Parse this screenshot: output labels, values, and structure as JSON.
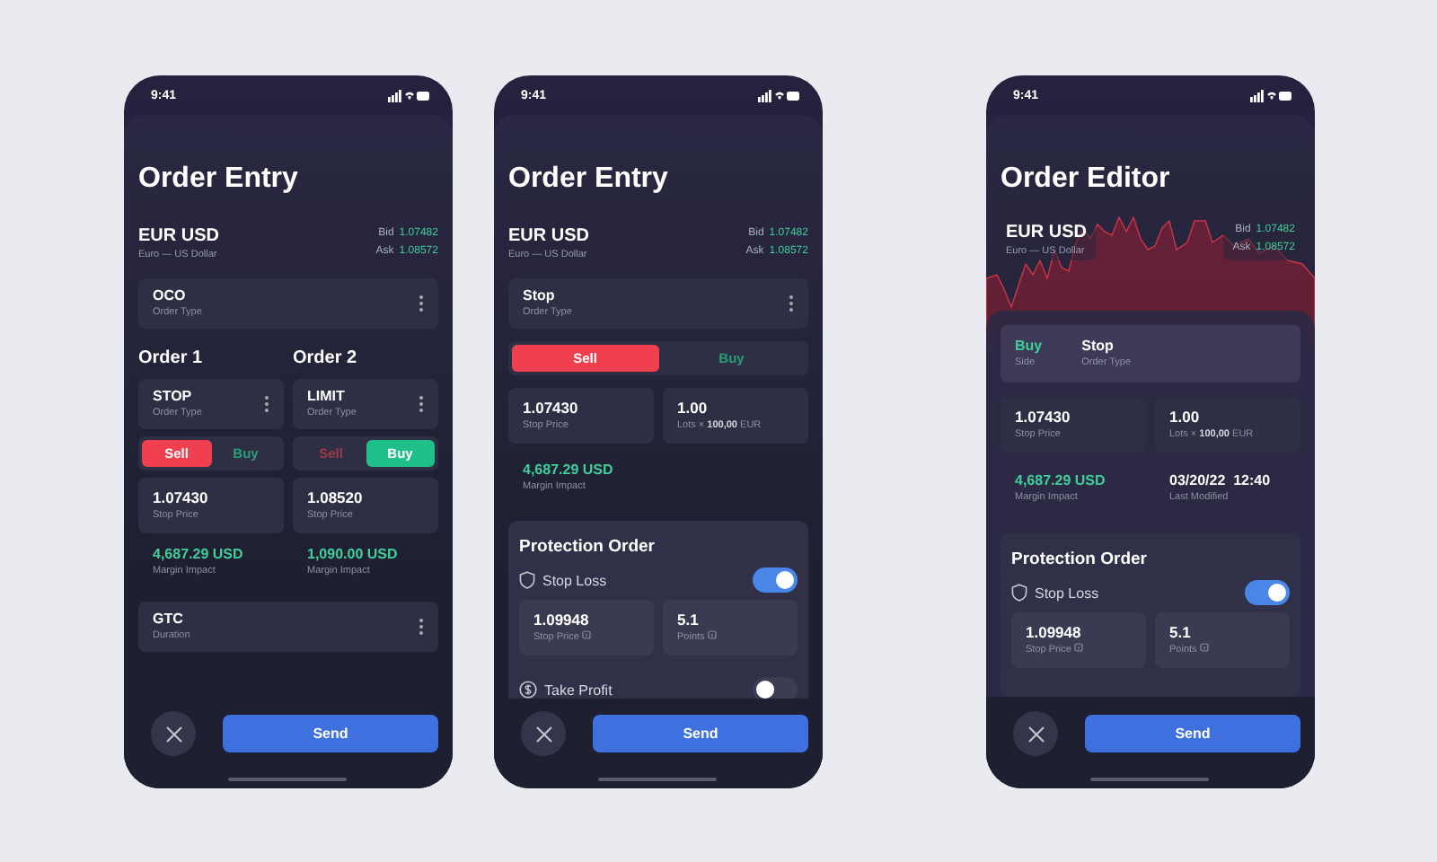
{
  "screens": [
    {
      "time": "9:41",
      "title": "Order Entry",
      "chart": false,
      "pair": {
        "symbol": "EUR USD",
        "name": "Euro — US Dollar",
        "quotes": [
          {
            "label": "Bid",
            "value": "1.07482"
          },
          {
            "label": "Ask",
            "value": "1.08572"
          }
        ]
      },
      "blocks": [
        {
          "kind": "select",
          "value": "OCO",
          "label": "Order Type"
        },
        {
          "kind": "columns",
          "columns": [
            {
              "heading": "Order 1",
              "order_type": {
                "value": "STOP",
                "label": "Order Type"
              },
              "sides": [
                {
                  "label": "Sell",
                  "kind": "sell",
                  "selected": true
                },
                {
                  "label": "Buy",
                  "kind": "buy",
                  "selected": false
                }
              ],
              "field": {
                "value": "1.07430",
                "label": "Stop Price"
              },
              "stat": {
                "value": "4,687.29 USD",
                "label": "Margin Impact",
                "kind": "positive"
              }
            },
            {
              "heading": "Order 2",
              "order_type": {
                "value": "LIMIT",
                "label": "Order Type"
              },
              "sides": [
                {
                  "label": "Sell",
                  "kind": "sell",
                  "selected": false
                },
                {
                  "label": "Buy",
                  "kind": "buy",
                  "selected": true
                }
              ],
              "field": {
                "value": "1.08520",
                "label": "Stop Price"
              },
              "stat": {
                "value": "1,090.00 USD",
                "label": "Margin Impact",
                "kind": "positive"
              }
            }
          ]
        },
        {
          "kind": "select",
          "value": "GTC",
          "label": "Duration"
        }
      ],
      "send": "Send"
    },
    {
      "time": "9:41",
      "title": "Order Entry",
      "chart": false,
      "pair": {
        "symbol": "EUR USD",
        "name": "Euro — US Dollar",
        "quotes": [
          {
            "label": "Bid",
            "value": "1.07482"
          },
          {
            "label": "Ask",
            "value": "1.08572"
          }
        ]
      },
      "blocks": [
        {
          "kind": "select",
          "value": "Stop",
          "label": "Order Type"
        },
        {
          "kind": "sides",
          "sides": [
            {
              "label": "Sell",
              "kind": "sell",
              "selected": true
            },
            {
              "label": "Buy",
              "kind": "buy",
              "selected": false
            }
          ]
        },
        {
          "kind": "fields",
          "fields": [
            {
              "value": "1.07430",
              "label": "Stop Price"
            },
            {
              "value": "1.00",
              "label": "Lots × **100,00** EUR"
            }
          ]
        },
        {
          "kind": "stats",
          "stats": [
            {
              "value": "4,687.29 USD",
              "label": "Margin Impact",
              "kind": "positive"
            }
          ]
        },
        {
          "kind": "protection",
          "title": "Protection Order",
          "rows": [
            {
              "label": "Stop Loss",
              "kind": "shield",
              "on": true,
              "fields": [
                {
                  "value": "1.09948",
                  "label": "Stop Price"
                },
                {
                  "value": "5.1",
                  "label": "Points"
                }
              ]
            },
            {
              "label": "Take Profit",
              "kind": "coin",
              "on": false,
              "fields": []
            }
          ]
        }
      ],
      "send": "Send"
    },
    {
      "time": "9:41",
      "title": "Order Editor",
      "chart": true,
      "pair": {
        "symbol": "EUR USD",
        "name": "Euro — US Dollar",
        "quotes": [
          {
            "label": "Bid",
            "value": "1.07482"
          },
          {
            "label": "Ask",
            "value": "1.08572"
          }
        ]
      },
      "blocks": [
        {
          "kind": "summary",
          "items": [
            {
              "value": "Buy",
              "label": "Side",
              "kind": "buy"
            },
            {
              "value": "Stop",
              "label": "Order Type",
              "kind": "plain"
            }
          ]
        },
        {
          "kind": "fields",
          "fields": [
            {
              "value": "1.07430",
              "label": "Stop Price"
            },
            {
              "value": "1.00",
              "label": "Lots × **100,00** EUR"
            }
          ]
        },
        {
          "kind": "stats",
          "stats": [
            {
              "value": "4,687.29 USD",
              "label": "Margin Impact",
              "kind": "positive"
            },
            {
              "value": "03/20/22  12:40",
              "label": "Last Modified",
              "kind": "plain"
            }
          ]
        },
        {
          "kind": "protection",
          "title": "Protection Order",
          "rows": [
            {
              "label": "Stop Loss",
              "kind": "shield",
              "on": true,
              "fields": [
                {
                  "value": "1.09948",
                  "label": "Stop Price"
                },
                {
                  "value": "5.1",
                  "label": "Points"
                }
              ]
            }
          ]
        }
      ],
      "send": "Send"
    }
  ]
}
